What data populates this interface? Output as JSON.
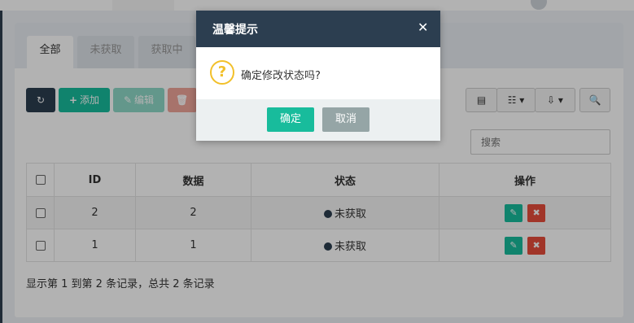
{
  "tabs": [
    {
      "label": "全部"
    },
    {
      "label": "未获取"
    },
    {
      "label": "获取中"
    }
  ],
  "toolbar": {
    "refresh_icon": "refresh-icon",
    "add_label": "添加",
    "edit_label": "编辑",
    "delete_label": "删除",
    "columns_icon": "list-icon",
    "toggle_icon": "grid-icon",
    "export_icon": "export-icon",
    "search_icon": "search-icon"
  },
  "search": {
    "placeholder": "搜索"
  },
  "table": {
    "headers": [
      "ID",
      "数据",
      "状态",
      "操作"
    ],
    "rows": [
      {
        "id": "2",
        "data": "2",
        "status": "未获取"
      },
      {
        "id": "1",
        "data": "1",
        "status": "未获取"
      }
    ]
  },
  "footer": {
    "summary": "显示第 1 到第 2 条记录，总共 2 条记录"
  },
  "dialog": {
    "title": "温馨提示",
    "message": "确定修改状态吗?",
    "ok_label": "确定",
    "cancel_label": "取消"
  },
  "colors": {
    "primary_dark": "#2c3e50",
    "success": "#18bc9c",
    "danger": "#e74c3c",
    "warning_icon": "#f2c02a",
    "cancel_gray": "#95a5a6"
  }
}
